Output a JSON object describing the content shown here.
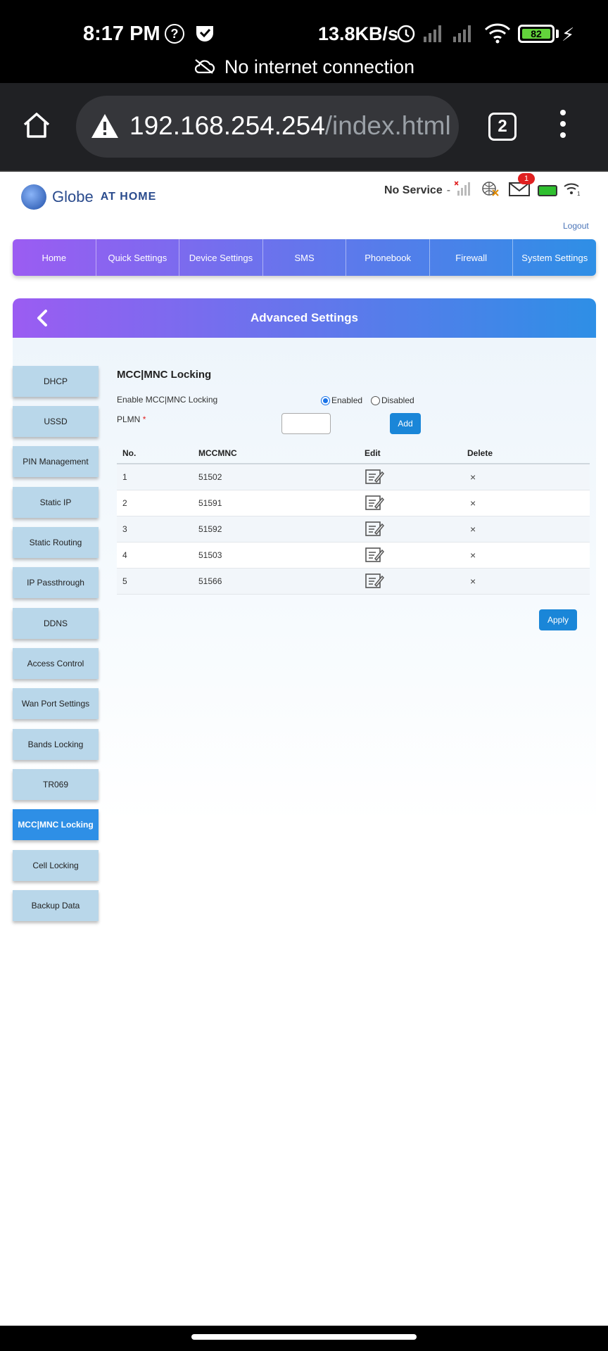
{
  "status_bar": {
    "time": "8:17 PM",
    "net_speed": "13.8KB/s",
    "battery": "82",
    "no_internet": "No internet connection"
  },
  "browser": {
    "url_host": "192.168.254.254",
    "url_path": "/index.html",
    "tab_count": "2"
  },
  "header": {
    "brand": "Globe",
    "brand_sub": "AT HOME",
    "service_status": "No Service",
    "dash": "-",
    "mail_count": "1",
    "logout": "Logout"
  },
  "nav": {
    "items": [
      "Home",
      "Quick Settings",
      "Device Settings",
      "SMS",
      "Phonebook",
      "Firewall",
      "System Settings"
    ]
  },
  "panel": {
    "title": "Advanced Settings"
  },
  "sidebar": {
    "items": [
      "DHCP",
      "USSD",
      "PIN Management",
      "Static IP",
      "Static Routing",
      "IP Passthrough",
      "DDNS",
      "Access Control",
      "Wan Port Settings",
      "Bands Locking",
      "TR069",
      "MCC|MNC Locking",
      "Cell Locking",
      "Backup Data"
    ],
    "active": "MCC|MNC Locking"
  },
  "content": {
    "title": "MCC|MNC Locking",
    "enable_label": "Enable MCC|MNC Locking",
    "enabled_label": "Enabled",
    "disabled_label": "Disabled",
    "plmn_label": "PLMN",
    "required_mark": "*",
    "plmn_value": "",
    "add_label": "Add",
    "apply_label": "Apply"
  },
  "table": {
    "headers": [
      "No.",
      "MCCMNC",
      "Edit",
      "Delete"
    ],
    "rows": [
      {
        "no": "1",
        "mccmnc": "51502"
      },
      {
        "no": "2",
        "mccmnc": "51591"
      },
      {
        "no": "3",
        "mccmnc": "51592"
      },
      {
        "no": "4",
        "mccmnc": "51503"
      },
      {
        "no": "5",
        "mccmnc": "51566"
      }
    ],
    "delete_glyph": "×"
  },
  "colors": {
    "gradient_start": "#9b5cf2",
    "gradient_end": "#2e8fe6",
    "sidebar_bg": "#b9d7ea",
    "accent_blue": "#1a86d8"
  }
}
